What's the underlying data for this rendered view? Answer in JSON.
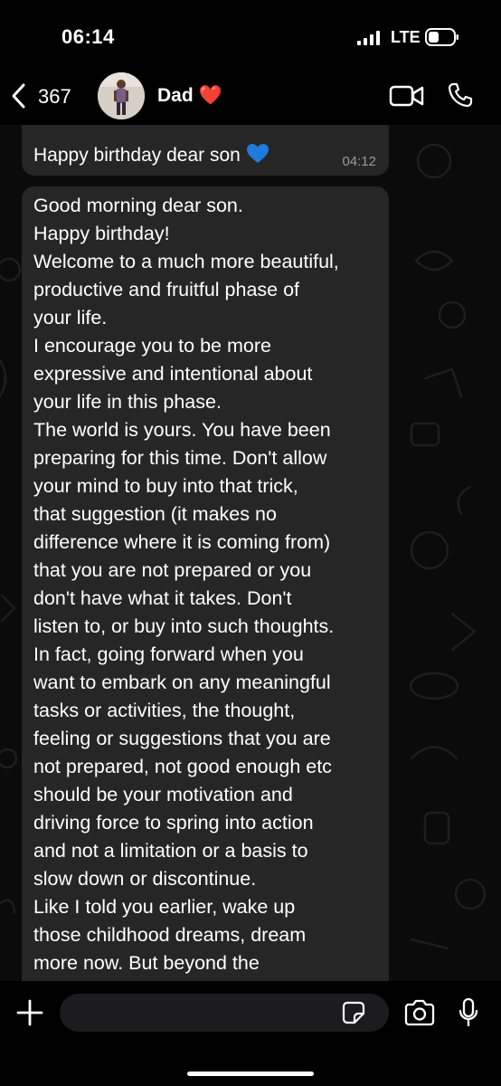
{
  "status_bar": {
    "time": "06:14",
    "network": "LTE"
  },
  "header": {
    "back_count": "367",
    "contact_name": "Dad ❤️"
  },
  "messages": [
    {
      "text": "Happy birthday dear son",
      "time": "04:12"
    },
    {
      "lines": [
        "Good morning dear son.",
        "Happy birthday!",
        "Welcome to a much more beautiful,",
        "productive and fruitful phase of",
        "your life.",
        "I encourage you to be more",
        "expressive and intentional about",
        "your life in this phase.",
        "The world is yours. You have been",
        "preparing for this time. Don't allow",
        "your mind to buy into that trick,",
        "that suggestion (it makes no",
        "difference where it is coming from)",
        "that you are not prepared or you",
        "don't have what it takes. Don't",
        "listen to, or buy into such thoughts.",
        "In fact, going forward when you",
        "want to embark on any meaningful",
        "tasks or activities, the thought,",
        "feeling  or suggestions that you are",
        "not prepared, not good enough etc",
        "should be your motivation and",
        "driving force to spring into action",
        "and not a limitation or a basis to",
        "slow down or discontinue.",
        "Like I told you earlier, wake up",
        "those childhood dreams, dream",
        "more now. But beyond the"
      ]
    }
  ],
  "composer": {
    "placeholder": ""
  },
  "colors": {
    "bubble": "#262626",
    "background": "#0b0b0b",
    "heart_blue": "#1f7bdc"
  }
}
